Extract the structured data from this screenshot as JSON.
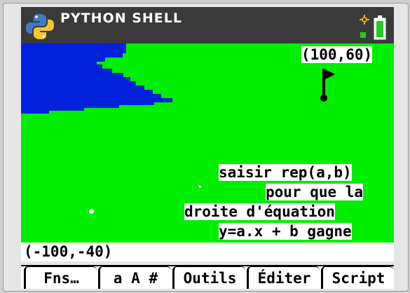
{
  "app": {
    "title": "PYTHON SHELL"
  },
  "screen": {
    "background_color": "#00ee00",
    "lake_color": "#0022dd",
    "target_coord": "(100,60)",
    "origin_coord": "(-100,-40)",
    "instructions": [
      "saisir rep(a,b)",
      "pour que la",
      "droite d'équation",
      "y=a.x + b gagne"
    ],
    "icons": {
      "flag": "flag-icon",
      "ball": "ball-dot"
    }
  },
  "softkeys": [
    {
      "label": "Fns…"
    },
    {
      "label": "a A #"
    },
    {
      "label": "Outils"
    },
    {
      "label": "Éditer"
    },
    {
      "label": "Script"
    }
  ]
}
